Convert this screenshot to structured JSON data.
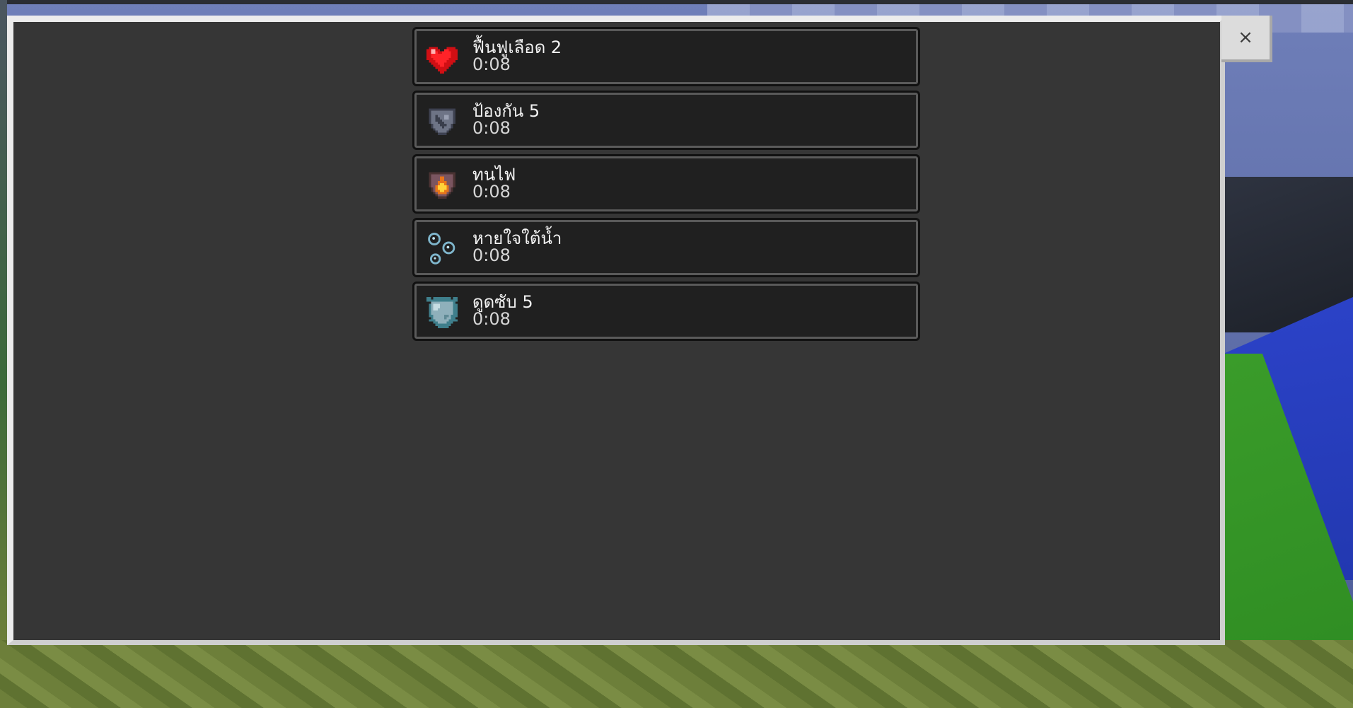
{
  "dialog": {
    "close_label": "×"
  },
  "effects": [
    {
      "name": "ฟื้นฟูเลือด 2",
      "time": "0:08",
      "icon": "heart-icon",
      "color": "#e8151b"
    },
    {
      "name": "ป้องกัน 5",
      "time": "0:08",
      "icon": "resistance-shield-icon",
      "color": "#6e7486"
    },
    {
      "name": "ทนไฟ",
      "time": "0:08",
      "icon": "fire-shield-icon",
      "color": "#e88a1a"
    },
    {
      "name": "หายใจใต้น้ำ",
      "time": "0:08",
      "icon": "bubbles-icon",
      "color": "#7fb6cc"
    },
    {
      "name": "ดูดซับ 5",
      "time": "0:08",
      "icon": "absorption-shield-icon",
      "color": "#8fb0bb"
    }
  ]
}
